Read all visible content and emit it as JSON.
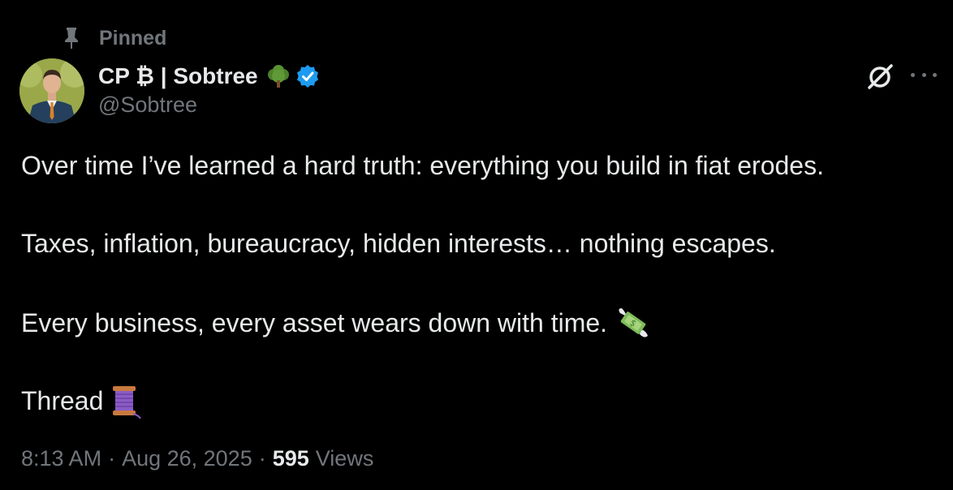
{
  "pinned": {
    "label": "Pinned",
    "icon": "pin-icon"
  },
  "author": {
    "display_name": "CP ₿ | Sobtree",
    "handle": "@Sobtree",
    "badges": [
      "tree-emoji-icon",
      "verified-badge-icon"
    ],
    "verified_color": "#1d9bf0"
  },
  "actions": {
    "grok_icon": "grok-icon",
    "more_icon": "more-icon"
  },
  "tweet": {
    "lines": [
      "Over time I’ve learned a hard truth: everything you build in fiat erodes.",
      "Taxes, inflation, bureaucracy, hidden interests… nothing escapes.",
      "Every business, every asset wears down with time.",
      "Thread"
    ],
    "emojis": [
      "money-with-wings-icon",
      "thread-spool-icon"
    ]
  },
  "meta": {
    "time": "8:13 AM",
    "separator": "·",
    "date": "Aug 26, 2025",
    "views_count": "595",
    "views_label": "Views"
  },
  "colors": {
    "background": "#000000",
    "text": "#e7e9ea",
    "muted": "#71767b"
  }
}
